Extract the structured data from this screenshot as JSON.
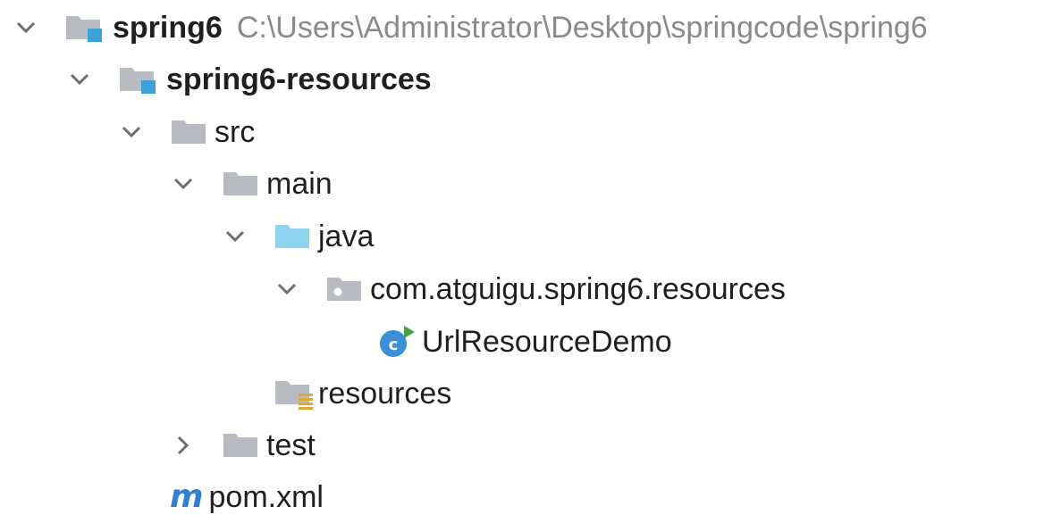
{
  "tree": {
    "root": {
      "name": "spring6",
      "path": "C:\\Users\\Administrator\\Desktop\\springcode\\spring6",
      "expanded": true,
      "icon": "module-folder-icon"
    },
    "module": {
      "name": "spring6-resources",
      "expanded": true,
      "icon": "module-folder-icon"
    },
    "src": {
      "name": "src",
      "expanded": true,
      "icon": "folder-icon"
    },
    "main": {
      "name": "main",
      "expanded": true,
      "icon": "folder-icon"
    },
    "java": {
      "name": "java",
      "expanded": true,
      "icon": "source-root-folder-icon"
    },
    "package": {
      "name": "com.atguigu.spring6.resources",
      "expanded": true,
      "icon": "package-icon"
    },
    "class": {
      "name": "UrlResourceDemo",
      "icon": "java-class-runnable-icon"
    },
    "resources": {
      "name": "resources",
      "icon": "resources-root-folder-icon"
    },
    "test": {
      "name": "test",
      "expanded": false,
      "icon": "folder-icon"
    },
    "pom": {
      "name": "pom.xml",
      "icon": "maven-m",
      "icon_glyph": "m"
    }
  },
  "colors": {
    "chevron": "#6e6e6e",
    "folder_gray": "#b8bcc2",
    "folder_blue": "#8dd3ee",
    "module_square": "#3aa2d8",
    "class_circle": "#3b8fd6",
    "run_arrow": "#45a145",
    "path_text": "#8a8a8a",
    "maven": "#2f7fd3"
  }
}
